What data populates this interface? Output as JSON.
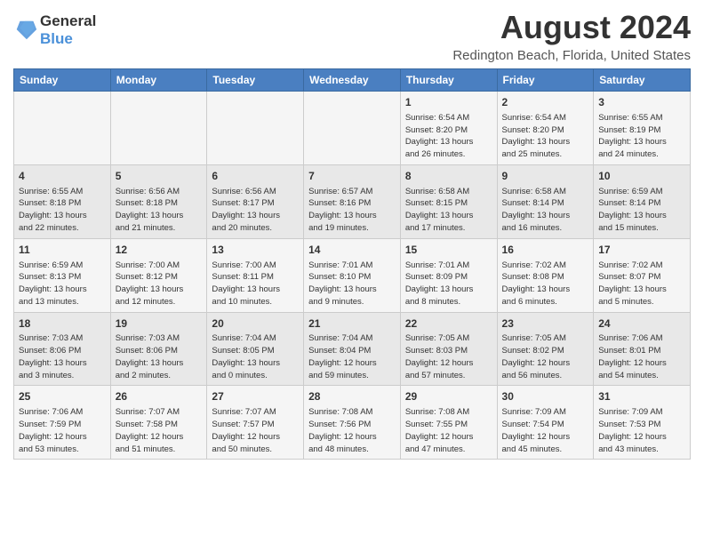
{
  "logo": {
    "line1": "General",
    "line2": "Blue"
  },
  "title": "August 2024",
  "subtitle": "Redington Beach, Florida, United States",
  "headers": [
    "Sunday",
    "Monday",
    "Tuesday",
    "Wednesday",
    "Thursday",
    "Friday",
    "Saturday"
  ],
  "weeks": [
    [
      {
        "day": "",
        "info": ""
      },
      {
        "day": "",
        "info": ""
      },
      {
        "day": "",
        "info": ""
      },
      {
        "day": "",
        "info": ""
      },
      {
        "day": "1",
        "info": "Sunrise: 6:54 AM\nSunset: 8:20 PM\nDaylight: 13 hours\nand 26 minutes."
      },
      {
        "day": "2",
        "info": "Sunrise: 6:54 AM\nSunset: 8:20 PM\nDaylight: 13 hours\nand 25 minutes."
      },
      {
        "day": "3",
        "info": "Sunrise: 6:55 AM\nSunset: 8:19 PM\nDaylight: 13 hours\nand 24 minutes."
      }
    ],
    [
      {
        "day": "4",
        "info": "Sunrise: 6:55 AM\nSunset: 8:18 PM\nDaylight: 13 hours\nand 22 minutes."
      },
      {
        "day": "5",
        "info": "Sunrise: 6:56 AM\nSunset: 8:18 PM\nDaylight: 13 hours\nand 21 minutes."
      },
      {
        "day": "6",
        "info": "Sunrise: 6:56 AM\nSunset: 8:17 PM\nDaylight: 13 hours\nand 20 minutes."
      },
      {
        "day": "7",
        "info": "Sunrise: 6:57 AM\nSunset: 8:16 PM\nDaylight: 13 hours\nand 19 minutes."
      },
      {
        "day": "8",
        "info": "Sunrise: 6:58 AM\nSunset: 8:15 PM\nDaylight: 13 hours\nand 17 minutes."
      },
      {
        "day": "9",
        "info": "Sunrise: 6:58 AM\nSunset: 8:14 PM\nDaylight: 13 hours\nand 16 minutes."
      },
      {
        "day": "10",
        "info": "Sunrise: 6:59 AM\nSunset: 8:14 PM\nDaylight: 13 hours\nand 15 minutes."
      }
    ],
    [
      {
        "day": "11",
        "info": "Sunrise: 6:59 AM\nSunset: 8:13 PM\nDaylight: 13 hours\nand 13 minutes."
      },
      {
        "day": "12",
        "info": "Sunrise: 7:00 AM\nSunset: 8:12 PM\nDaylight: 13 hours\nand 12 minutes."
      },
      {
        "day": "13",
        "info": "Sunrise: 7:00 AM\nSunset: 8:11 PM\nDaylight: 13 hours\nand 10 minutes."
      },
      {
        "day": "14",
        "info": "Sunrise: 7:01 AM\nSunset: 8:10 PM\nDaylight: 13 hours\nand 9 minutes."
      },
      {
        "day": "15",
        "info": "Sunrise: 7:01 AM\nSunset: 8:09 PM\nDaylight: 13 hours\nand 8 minutes."
      },
      {
        "day": "16",
        "info": "Sunrise: 7:02 AM\nSunset: 8:08 PM\nDaylight: 13 hours\nand 6 minutes."
      },
      {
        "day": "17",
        "info": "Sunrise: 7:02 AM\nSunset: 8:07 PM\nDaylight: 13 hours\nand 5 minutes."
      }
    ],
    [
      {
        "day": "18",
        "info": "Sunrise: 7:03 AM\nSunset: 8:06 PM\nDaylight: 13 hours\nand 3 minutes."
      },
      {
        "day": "19",
        "info": "Sunrise: 7:03 AM\nSunset: 8:06 PM\nDaylight: 13 hours\nand 2 minutes."
      },
      {
        "day": "20",
        "info": "Sunrise: 7:04 AM\nSunset: 8:05 PM\nDaylight: 13 hours\nand 0 minutes."
      },
      {
        "day": "21",
        "info": "Sunrise: 7:04 AM\nSunset: 8:04 PM\nDaylight: 12 hours\nand 59 minutes."
      },
      {
        "day": "22",
        "info": "Sunrise: 7:05 AM\nSunset: 8:03 PM\nDaylight: 12 hours\nand 57 minutes."
      },
      {
        "day": "23",
        "info": "Sunrise: 7:05 AM\nSunset: 8:02 PM\nDaylight: 12 hours\nand 56 minutes."
      },
      {
        "day": "24",
        "info": "Sunrise: 7:06 AM\nSunset: 8:01 PM\nDaylight: 12 hours\nand 54 minutes."
      }
    ],
    [
      {
        "day": "25",
        "info": "Sunrise: 7:06 AM\nSunset: 7:59 PM\nDaylight: 12 hours\nand 53 minutes."
      },
      {
        "day": "26",
        "info": "Sunrise: 7:07 AM\nSunset: 7:58 PM\nDaylight: 12 hours\nand 51 minutes."
      },
      {
        "day": "27",
        "info": "Sunrise: 7:07 AM\nSunset: 7:57 PM\nDaylight: 12 hours\nand 50 minutes."
      },
      {
        "day": "28",
        "info": "Sunrise: 7:08 AM\nSunset: 7:56 PM\nDaylight: 12 hours\nand 48 minutes."
      },
      {
        "day": "29",
        "info": "Sunrise: 7:08 AM\nSunset: 7:55 PM\nDaylight: 12 hours\nand 47 minutes."
      },
      {
        "day": "30",
        "info": "Sunrise: 7:09 AM\nSunset: 7:54 PM\nDaylight: 12 hours\nand 45 minutes."
      },
      {
        "day": "31",
        "info": "Sunrise: 7:09 AM\nSunset: 7:53 PM\nDaylight: 12 hours\nand 43 minutes."
      }
    ]
  ]
}
